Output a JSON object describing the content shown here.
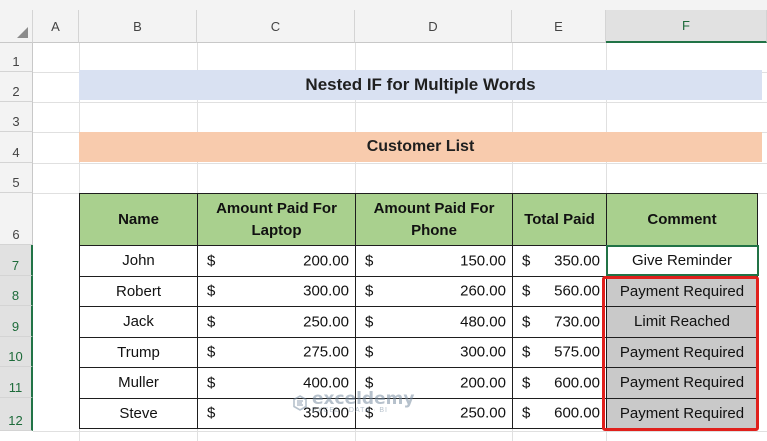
{
  "columns": [
    "A",
    "B",
    "C",
    "D",
    "E",
    "F"
  ],
  "rows": [
    "1",
    "2",
    "3",
    "4",
    "5",
    "6",
    "7",
    "8",
    "9",
    "10",
    "11",
    "12"
  ],
  "title": "Nested IF for Multiple Words",
  "subtitle": "Customer List",
  "table": {
    "headers": {
      "name": "Name",
      "laptop": "Amount Paid For Laptop",
      "phone": "Amount Paid For Phone",
      "total": "Total Paid",
      "comment": "Comment"
    },
    "currency": "$",
    "rows": [
      {
        "name": "John",
        "laptop": "200.00",
        "phone": "150.00",
        "total": "350.00",
        "comment": "Give Reminder"
      },
      {
        "name": "Robert",
        "laptop": "300.00",
        "phone": "260.00",
        "total": "560.00",
        "comment": "Payment Required"
      },
      {
        "name": "Jack",
        "laptop": "250.00",
        "phone": "480.00",
        "total": "730.00",
        "comment": "Limit Reached"
      },
      {
        "name": "Trump",
        "laptop": "275.00",
        "phone": "300.00",
        "total": "575.00",
        "comment": "Payment Required"
      },
      {
        "name": "Muller",
        "laptop": "400.00",
        "phone": "200.00",
        "total": "600.00",
        "comment": "Payment Required"
      },
      {
        "name": "Steve",
        "laptop": "350.00",
        "phone": "250.00",
        "total": "600.00",
        "comment": "Payment Required"
      }
    ]
  },
  "watermark": {
    "name": "exceldemy",
    "tag": "EXCEL · DATA · BI"
  },
  "colors": {
    "title_bg": "#d9e1f2",
    "subtitle_bg": "#f8cbad",
    "header_bg": "#a9d08e",
    "highlight": "#c9c9c9",
    "outline": "#e0201c",
    "selection": "#217346"
  }
}
